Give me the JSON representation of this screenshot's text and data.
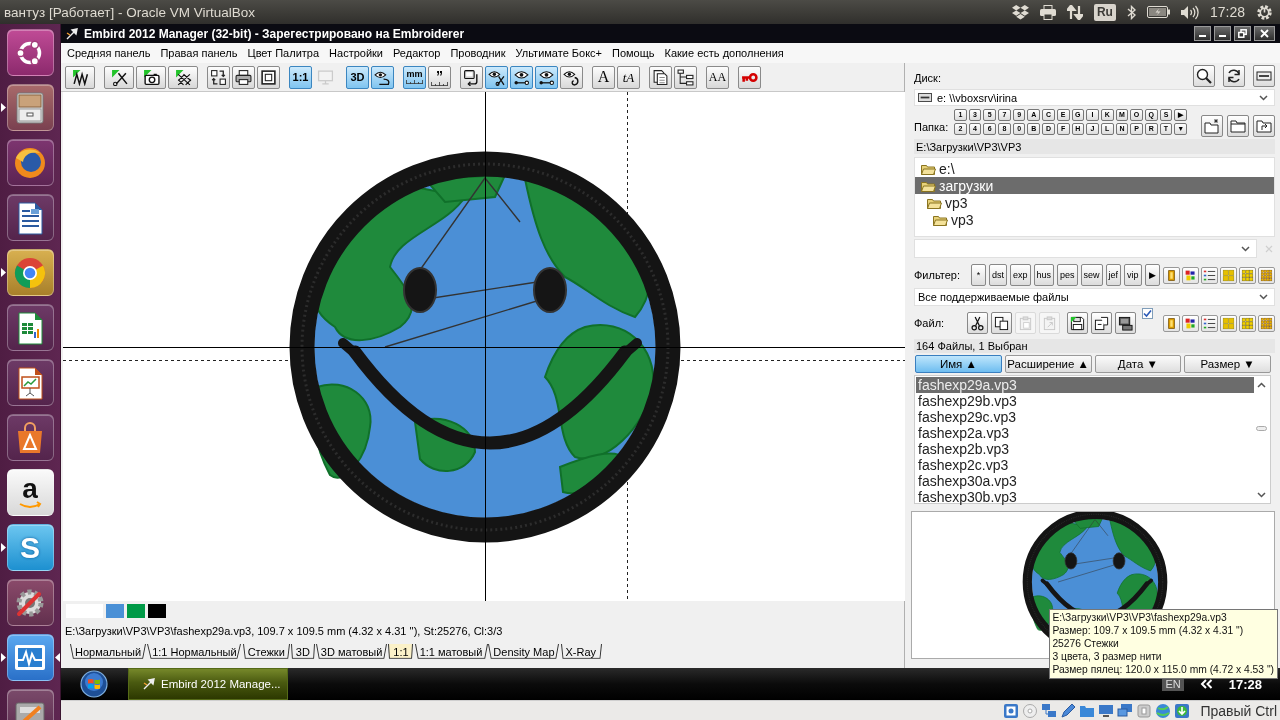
{
  "top_bar": {
    "title": "вантуз [Работает] - Oracle VM VirtualBox",
    "keyboard": "Ru",
    "clock": "17:28"
  },
  "launcher": [
    {
      "kind": "ubuntu",
      "running": false,
      "focused": false
    },
    {
      "kind": "files",
      "running": true,
      "focused": false
    },
    {
      "kind": "firefox",
      "running": false,
      "focused": false
    },
    {
      "kind": "writer",
      "running": false,
      "focused": false
    },
    {
      "kind": "chrome",
      "running": true,
      "focused": false
    },
    {
      "kind": "calc",
      "running": false,
      "focused": false
    },
    {
      "kind": "impress",
      "running": false,
      "focused": false
    },
    {
      "kind": "store",
      "running": false,
      "focused": false
    },
    {
      "kind": "amazon",
      "glyph": "a",
      "running": false,
      "focused": false
    },
    {
      "kind": "skype",
      "glyph": "S",
      "running": true,
      "focused": false
    },
    {
      "kind": "settings",
      "running": false,
      "focused": false
    },
    {
      "kind": "monitor",
      "running": true,
      "focused": true
    },
    {
      "kind": "tools",
      "running": false,
      "focused": false
    }
  ],
  "window": {
    "title": "Embird 2012 Manager (32-bit) - Зарегестрировано на Embroiderer"
  },
  "menu": [
    "Средняя панель",
    "Правая панель",
    "Цвет Палитра",
    "Настройки",
    "Редактор",
    "Проводник",
    "Ультимате Бокс+",
    "Помощь",
    "Какие есть дополнения"
  ],
  "toolbar": [
    [
      {
        "kind": "stitch",
        "selected": false,
        "disabled": false
      }
    ],
    [
      {
        "kind": "trim",
        "selected": false,
        "disabled": false
      },
      {
        "kind": "camera",
        "selected": false,
        "disabled": false
      },
      {
        "kind": "crosshatch",
        "selected": false,
        "disabled": false
      }
    ],
    [
      {
        "kind": "convert",
        "selected": false,
        "disabled": false
      },
      {
        "kind": "print",
        "selected": false,
        "disabled": false
      },
      {
        "kind": "frame",
        "selected": false,
        "disabled": false
      }
    ],
    [
      {
        "kind": "ratio",
        "label": "1:1",
        "selected": true,
        "disabled": false
      },
      {
        "kind": "monitor",
        "selected": false,
        "disabled": true
      }
    ],
    [
      {
        "kind": "solid",
        "label": "3D",
        "selected": true,
        "disabled": false
      },
      {
        "kind": "figure",
        "selected": true,
        "disabled": false
      }
    ],
    [
      {
        "kind": "units",
        "label": "mm",
        "selected": true,
        "disabled": false
      },
      {
        "kind": "inch",
        "label": "”",
        "selected": false,
        "disabled": false
      }
    ],
    [
      {
        "kind": "machine",
        "selected": false,
        "disabled": false
      },
      {
        "kind": "snip",
        "selected": true,
        "disabled": false
      },
      {
        "kind": "eye",
        "selected": true,
        "disabled": false
      },
      {
        "kind": "eye",
        "selected": true,
        "disabled": false
      },
      {
        "kind": "loop",
        "selected": false,
        "disabled": false
      }
    ],
    [
      {
        "kind": "letter",
        "label": "A",
        "selected": false,
        "disabled": false
      },
      {
        "kind": "lettering",
        "label": "tA",
        "selected": false,
        "disabled": false
      }
    ],
    [
      {
        "kind": "pages",
        "selected": false,
        "disabled": false
      },
      {
        "kind": "tree",
        "selected": false,
        "disabled": false
      }
    ],
    [
      {
        "kind": "font",
        "label": "AA",
        "selected": false,
        "disabled": false
      }
    ],
    [
      {
        "kind": "key",
        "selected": false,
        "disabled": false
      }
    ]
  ],
  "swatches": [
    {
      "kind": "background",
      "color": "#ffffff"
    },
    {
      "kind": "thread",
      "color": "#4a90d6"
    },
    {
      "kind": "thread",
      "color": "#009a47"
    },
    {
      "kind": "thread",
      "color": "#000000"
    }
  ],
  "status_text": "E:\\Загрузки\\VP3\\VP3\\fashexp29a.vp3, 109.7 x 109.5 mm (4.32 x 4.31 ''), St:25276, Cl:3/3",
  "view_tabs": [
    {
      "label": "Нормальный",
      "selected": false
    },
    {
      "label": "1:1 Нормальный",
      "selected": false
    },
    {
      "label": "Стежки",
      "selected": false
    },
    {
      "label": "3D",
      "selected": false
    },
    {
      "label": "3D матовый",
      "selected": false
    },
    {
      "label": "1:1",
      "selected": true
    },
    {
      "label": "1:1 матовый",
      "selected": false
    },
    {
      "label": "Density Map",
      "selected": false
    },
    {
      "label": "X-Ray",
      "selected": false
    }
  ],
  "right_panel": {
    "disk_label": "Диск:",
    "drive": "e: \\\\vboxsrv\\irina",
    "folder_label": "Папка:",
    "folder_keys": [
      [
        "1",
        "3",
        "5",
        "7",
        "9",
        "A",
        "C",
        "E",
        "G",
        "I",
        "K",
        "M",
        "O",
        "Q",
        "S",
        "▶"
      ],
      [
        "2",
        "4",
        "6",
        "8",
        "0",
        "B",
        "D",
        "F",
        "H",
        "J",
        "L",
        "N",
        "P",
        "R",
        "T",
        "▼"
      ]
    ],
    "path": "E:\\Загрузки\\VP3\\VP3",
    "tree": [
      {
        "label": "e:\\",
        "selected": false,
        "children": [
          {
            "label": "загрузки",
            "selected": true,
            "children": [
              {
                "label": "vp3",
                "selected": false,
                "children": [
                  {
                    "label": "vp3",
                    "selected": false
                  }
                ]
              }
            ]
          }
        ]
      }
    ],
    "filter_label": "Фильтер:",
    "filters": [
      "*",
      "dst",
      "exp",
      "hus",
      "pes",
      "sew",
      "jef",
      "vip",
      "▶"
    ],
    "filter_select": "Все поддерживаемые файлы",
    "file_label": "Файл:",
    "file_tools": [
      {
        "kind": "cut",
        "disabled": false
      },
      {
        "kind": "copy",
        "disabled": false
      },
      {
        "kind": "paste",
        "disabled": true
      },
      {
        "kind": "pastelink",
        "disabled": true
      },
      {
        "kind": "save",
        "disabled": false
      },
      {
        "kind": "export",
        "disabled": false
      },
      {
        "kind": "machine",
        "disabled": false
      }
    ],
    "preview_checkbox": {
      "checked": true
    },
    "count": "164 Файлы, 1 Выбран",
    "columns": [
      {
        "label": "Имя ▲",
        "selected": true
      },
      {
        "label": "Расширение ▲",
        "selected": false
      },
      {
        "label": "Дата ▼",
        "selected": false
      },
      {
        "label": "Размер ▼",
        "selected": false
      }
    ],
    "files": [
      {
        "name": "fashexp29a.vp3",
        "selected": true
      },
      {
        "name": "fashexp29b.vp3",
        "selected": false
      },
      {
        "name": "fashexp29c.vp3",
        "selected": false
      },
      {
        "name": "fashexp2a.vp3",
        "selected": false
      },
      {
        "name": "fashexp2b.vp3",
        "selected": false
      },
      {
        "name": "fashexp2c.vp3",
        "selected": false
      },
      {
        "name": "fashexp30a.vp3",
        "selected": false
      },
      {
        "name": "fashexp30b.vp3",
        "selected": false
      }
    ]
  },
  "tooltip": [
    "E:\\Загрузки\\VP3\\VP3\\fashexp29a.vp3",
    "Размер: 109.7 x 109.5 mm (4.32 x 4.31 \")",
    "25276 Стежки",
    "3 цвета, 3 размер нити",
    "Размер пялец: 120.0 x 115.0 mm (4.72 x 4.53 \")"
  ],
  "taskbar": {
    "task": "Embird 2012 Manage...",
    "language": "EN",
    "clock": "17:28"
  },
  "vbox_status": {
    "host_key": "Правый Ctrl"
  }
}
